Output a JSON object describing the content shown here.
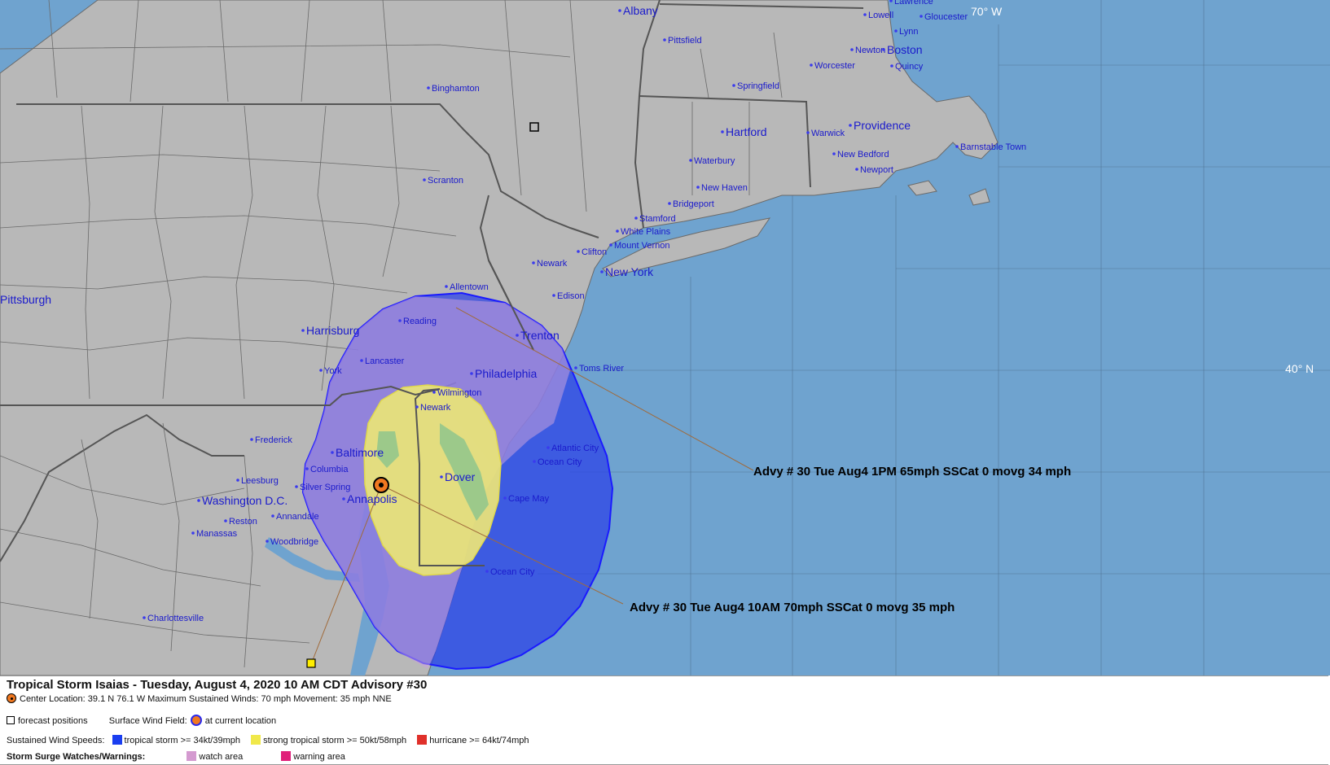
{
  "map": {
    "grid_labels": {
      "lon": "70° W",
      "lat": "40° N"
    },
    "cities": [
      {
        "name": "Albany",
        "size": "l"
      },
      {
        "name": "Lawrence",
        "size": "s"
      },
      {
        "name": "Lowell",
        "size": "s"
      },
      {
        "name": "Gloucester",
        "size": "s"
      },
      {
        "name": "Lynn",
        "size": "s"
      },
      {
        "name": "Pittsfield",
        "size": "s"
      },
      {
        "name": "Newton",
        "size": "s"
      },
      {
        "name": "Boston",
        "size": "l"
      },
      {
        "name": "Worcester",
        "size": "s"
      },
      {
        "name": "Quincy",
        "size": "s"
      },
      {
        "name": "Binghamton",
        "size": "s"
      },
      {
        "name": "Springfield",
        "size": "s"
      },
      {
        "name": "Hartford",
        "size": "l"
      },
      {
        "name": "Warwick",
        "size": "s"
      },
      {
        "name": "Providence",
        "size": "l"
      },
      {
        "name": "Barnstable Town",
        "size": "s"
      },
      {
        "name": "New Bedford",
        "size": "s"
      },
      {
        "name": "Waterbury",
        "size": "s"
      },
      {
        "name": "Newport",
        "size": "s"
      },
      {
        "name": "Scranton",
        "size": "s"
      },
      {
        "name": "New Haven",
        "size": "s"
      },
      {
        "name": "Bridgeport",
        "size": "s"
      },
      {
        "name": "Stamford",
        "size": "s"
      },
      {
        "name": "White Plains",
        "size": "s"
      },
      {
        "name": "Mount Vernon",
        "size": "s"
      },
      {
        "name": "Clifton",
        "size": "s"
      },
      {
        "name": "Newark",
        "size": "s"
      },
      {
        "name": "New York",
        "size": "l"
      },
      {
        "name": "Edison",
        "size": "s"
      },
      {
        "name": "Allentown",
        "size": "s"
      },
      {
        "name": "Pittsburgh",
        "size": "l"
      },
      {
        "name": "Reading",
        "size": "s"
      },
      {
        "name": "Harrisburg",
        "size": "l"
      },
      {
        "name": "Trenton",
        "size": "l"
      },
      {
        "name": "Lancaster",
        "size": "s"
      },
      {
        "name": "York",
        "size": "s"
      },
      {
        "name": "Philadelphia",
        "size": "l"
      },
      {
        "name": "Toms River",
        "size": "s"
      },
      {
        "name": "Wilmington",
        "size": "s"
      },
      {
        "name": "Newark",
        "size": "s"
      },
      {
        "name": "Frederick",
        "size": "s"
      },
      {
        "name": "Baltimore",
        "size": "l"
      },
      {
        "name": "Atlantic City",
        "size": "s"
      },
      {
        "name": "Ocean City",
        "size": "s"
      },
      {
        "name": "Columbia",
        "size": "s"
      },
      {
        "name": "Dover",
        "size": "l"
      },
      {
        "name": "Leesburg",
        "size": "s"
      },
      {
        "name": "Silver Spring",
        "size": "s"
      },
      {
        "name": "Washington D.C.",
        "size": "l"
      },
      {
        "name": "Annapolis",
        "size": "l"
      },
      {
        "name": "Cape May",
        "size": "s"
      },
      {
        "name": "Annandale",
        "size": "s"
      },
      {
        "name": "Reston",
        "size": "s"
      },
      {
        "name": "Manassas",
        "size": "s"
      },
      {
        "name": "Woodbridge",
        "size": "s"
      },
      {
        "name": "Ocean City",
        "size": "s"
      },
      {
        "name": "Charlottesville",
        "size": "s"
      }
    ],
    "advisories": [
      "Advy # 30 Tue Aug4 1PM  65mph SSCat 0 movg 34 mph",
      "Advy # 30 Tue Aug4 10AM  70mph SSCat 0 movg 35 mph"
    ],
    "colors": {
      "ocean": "#6fa3cf",
      "land": "#b8b8b8",
      "tropical_storm": "#4b6fe6",
      "strong_tropical_storm": "#e8e27a",
      "watch_area": "#c9a0dc",
      "storm_center": "#f07820"
    }
  },
  "legend": {
    "title": "Tropical Storm Isaias  -  Tuesday, August 4, 2020  10 AM CDT   Advisory #30",
    "center_info": "Center Location: 39.1 N  76.1 W   Maximum Sustained Winds: 70 mph  Movement: 35 mph NNE",
    "forecast_positions": "forecast positions",
    "surface_wind_field": "Surface Wind Field:",
    "at_current_location": "at current location",
    "sustained_wind_speeds": "Sustained Wind Speeds:",
    "tropical_storm": "tropical storm >= 34kt/39mph",
    "strong_tropical_storm": "strong tropical storm >= 50kt/58mph",
    "hurricane": "hurricane >= 64kt/74mph",
    "storm_surge": "Storm Surge Watches/Warnings:",
    "watch_area": "watch area",
    "warning_area": "warning area",
    "colors": {
      "tropical_storm": "#1a3ef0",
      "strong_tropical_storm": "#f0e84a",
      "hurricane": "#e0302a",
      "watch_area": "#d49ad0",
      "warning_area": "#e0207a"
    }
  }
}
